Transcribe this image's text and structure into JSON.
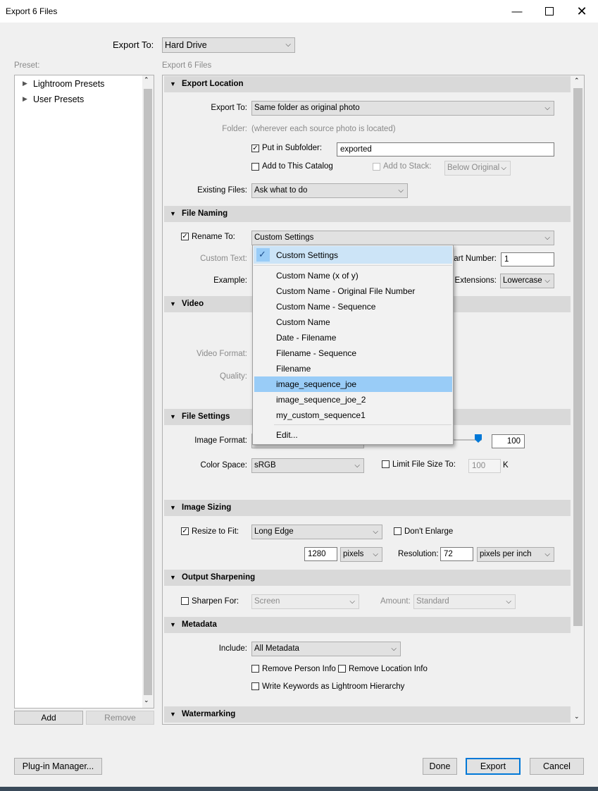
{
  "window": {
    "title": "Export 6 Files"
  },
  "export_to": {
    "label": "Export To:",
    "value": "Hard Drive"
  },
  "preset_panel": {
    "label": "Preset:",
    "items": [
      "Lightroom Presets",
      "User Presets"
    ],
    "add": "Add",
    "remove": "Remove"
  },
  "settings_header": "Export 6 Files",
  "sections": {
    "export_location": "Export Location",
    "file_naming": "File Naming",
    "video": "Video",
    "file_settings": "File Settings",
    "image_sizing": "Image Sizing",
    "output_sharpening": "Output Sharpening",
    "metadata": "Metadata",
    "watermarking": "Watermarking"
  },
  "export_location": {
    "export_to_label": "Export To:",
    "export_to_value": "Same folder as original photo",
    "folder_label": "Folder:",
    "folder_value": "(wherever each source photo is located)",
    "subfolder_label": "Put in Subfolder:",
    "subfolder_value": "exported",
    "add_catalog_label": "Add to This Catalog",
    "add_stack_label": "Add to Stack:",
    "add_stack_value": "Below Original",
    "existing_label": "Existing Files:",
    "existing_value": "Ask what to do"
  },
  "file_naming": {
    "rename_label": "Rename To:",
    "rename_value": "Custom Settings",
    "custom_text_label": "Custom Text:",
    "start_number_label": "Start Number:",
    "start_number_value": "1",
    "example_label": "Example:",
    "extensions_label": "Extensions:",
    "extensions_value": "Lowercase"
  },
  "video": {
    "format_label": "Video Format:",
    "quality_label": "Quality:"
  },
  "file_settings": {
    "image_format_label": "Image Format:",
    "quality_value": "100",
    "color_space_label": "Color Space:",
    "color_space_value": "sRGB",
    "limit_label": "Limit File Size To:",
    "limit_value": "100",
    "limit_unit": "K"
  },
  "image_sizing": {
    "resize_label": "Resize to Fit:",
    "resize_value": "Long Edge",
    "dont_enlarge_label": "Don't Enlarge",
    "size_value": "1280",
    "size_unit": "pixels",
    "resolution_label": "Resolution:",
    "resolution_value": "72",
    "resolution_unit": "pixels per inch"
  },
  "output_sharpening": {
    "sharpen_label": "Sharpen For:",
    "sharpen_value": "Screen",
    "amount_label": "Amount:",
    "amount_value": "Standard"
  },
  "metadata": {
    "include_label": "Include:",
    "include_value": "All Metadata",
    "remove_person": "Remove Person Info",
    "remove_location": "Remove Location Info",
    "write_keywords": "Write Keywords as Lightroom Hierarchy"
  },
  "dropdown_menu": {
    "checked": "Custom Settings",
    "items": [
      "Custom Name (x of y)",
      "Custom Name - Original File Number",
      "Custom Name - Sequence",
      "Custom Name",
      "Date - Filename",
      "Filename - Sequence",
      "Filename",
      "image_sequence_joe",
      "image_sequence_joe_2",
      "my_custom_sequence1"
    ],
    "highlighted": "image_sequence_joe",
    "edit": "Edit..."
  },
  "buttons": {
    "plugin": "Plug-in Manager...",
    "done": "Done",
    "export": "Export",
    "cancel": "Cancel"
  },
  "colors": {
    "menu_highlight": "#99ccf7",
    "section_header": "#d9d9d9",
    "export_border": "#0078d7"
  }
}
